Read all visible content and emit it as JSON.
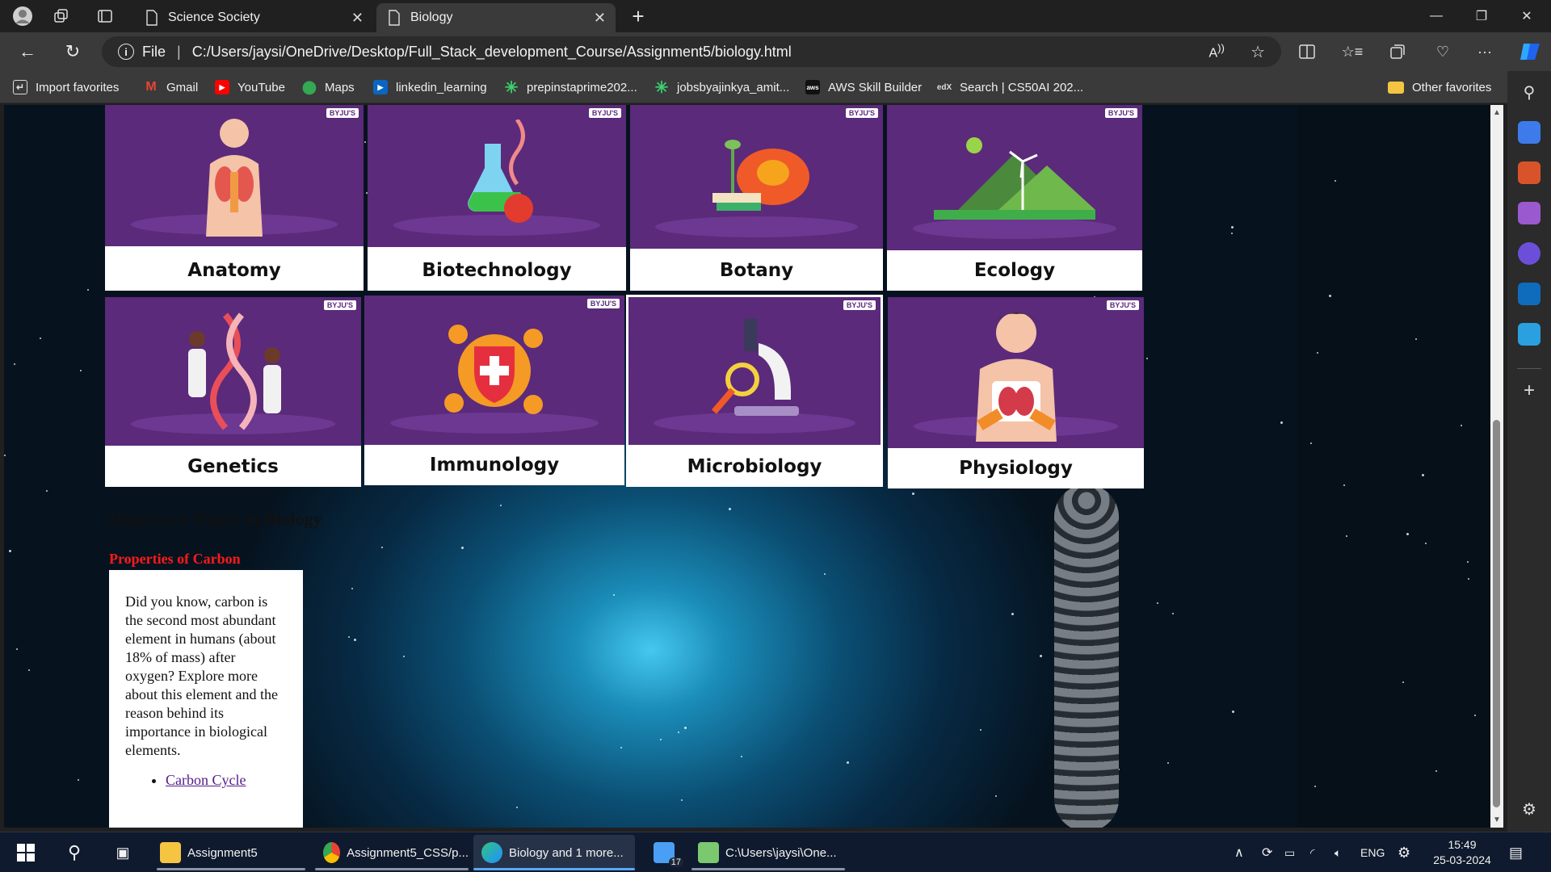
{
  "browser": {
    "tabs": [
      {
        "label": "Science Society",
        "active": false
      },
      {
        "label": "Biology",
        "active": true
      }
    ],
    "new_tab_symbol": "+",
    "address": {
      "scheme_label": "File",
      "url": "C:/Users/jaysi/OneDrive/Desktop/Full_Stack_development_Course/Assignment5/biology.html"
    },
    "favorites": [
      {
        "label": "Import favorites",
        "icon": "import-icon"
      },
      {
        "label": "Gmail",
        "icon": "gmail-icon"
      },
      {
        "label": "YouTube",
        "icon": "youtube-icon"
      },
      {
        "label": "Maps",
        "icon": "maps-icon"
      },
      {
        "label": "linkedin_learning",
        "icon": "linkedin-learning-icon"
      },
      {
        "label": "prepinstaprime202...",
        "icon": "asterisk-icon"
      },
      {
        "label": "jobsbyajinkya_amit...",
        "icon": "asterisk-icon"
      },
      {
        "label": "AWS Skill Builder",
        "icon": "aws-icon"
      },
      {
        "label": "Search | CS50AI 202...",
        "icon": "edx-icon"
      }
    ],
    "other_favorites": "Other favorites"
  },
  "page": {
    "cards": [
      {
        "label": "Anatomy",
        "logo": "BYJU'S",
        "motif": "human-organs"
      },
      {
        "label": "Biotechnology",
        "logo": "BYJU'S",
        "motif": "flask-dna"
      },
      {
        "label": "Botany",
        "logo": "BYJU'S",
        "motif": "flower"
      },
      {
        "label": "Ecology",
        "logo": "BYJU'S",
        "motif": "windmill-landscape"
      },
      {
        "label": "Genetics",
        "logo": "BYJU'S",
        "motif": "dna-scientists"
      },
      {
        "label": "Immunology",
        "logo": "BYJU'S",
        "motif": "virus-shield"
      },
      {
        "label": "Microbiology",
        "logo": "BYJU'S",
        "motif": "microscope"
      },
      {
        "label": "Physiology",
        "logo": "BYJU'S",
        "motif": "human-lungs"
      }
    ],
    "topics_heading": "Important Topics in Biology",
    "carbon_heading": "Properties of Carbon",
    "carbon_text": "Did you know, carbon is the second most abundant element in humans (about 18% of mass) after oxygen? Explore more about this element and the reason behind its importance in biological elements.",
    "carbon_link": "Carbon Cycle"
  },
  "taskbar": {
    "items": [
      {
        "label": "Assignment5",
        "icon": "folder-icon",
        "active": false
      },
      {
        "label": "Assignment5_CSS/p...",
        "icon": "chrome-icon",
        "active": false
      },
      {
        "label": "Biology and 1 more...",
        "icon": "edge-icon",
        "active": true
      },
      {
        "label": "",
        "icon": "mail-icon",
        "badge": "17",
        "active": false
      },
      {
        "label": "C:\\Users\\jaysi\\One...",
        "icon": "notepad-icon",
        "active": false
      }
    ],
    "language": "ENG",
    "time": "15:49",
    "date": "25-03-2024"
  },
  "colors": {
    "card_purple": "#5b2a7a",
    "carbon_heading": "#ff1a1a",
    "link": "#551a8b"
  }
}
